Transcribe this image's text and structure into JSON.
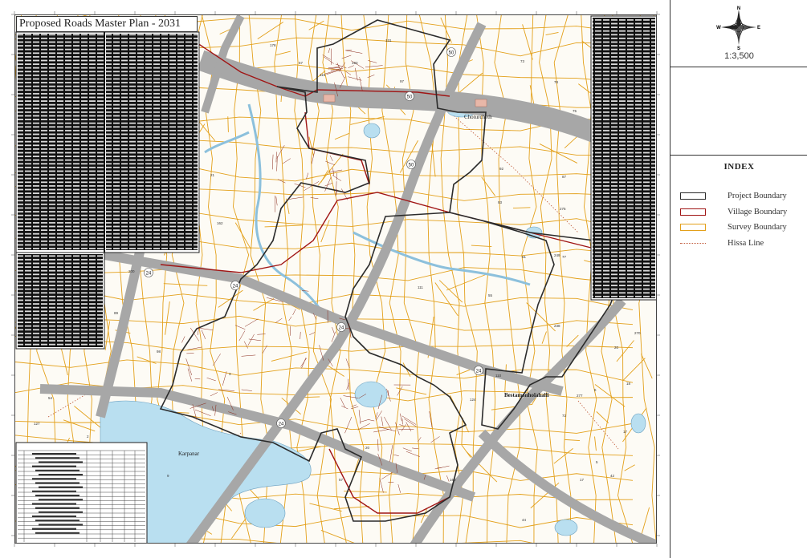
{
  "map": {
    "title": "Proposed Roads Master Plan - 2031",
    "scale": "1:3,500",
    "compass": {
      "n": "N",
      "s": "S",
      "e": "E",
      "w": "W"
    },
    "place_labels": [
      "Choturcheth",
      "Bestamonholahalli",
      "Karpanar"
    ],
    "road_labels": [
      "50",
      "50",
      "50",
      "24",
      "24",
      "24",
      "24",
      "24"
    ],
    "parcel_numbers": [
      "178",
      "57",
      "131",
      "193",
      "115",
      "97",
      "73",
      "78",
      "75",
      "87",
      "92",
      "93",
      "74",
      "61",
      "77",
      "55",
      "43",
      "54",
      "89",
      "98",
      "127",
      "2",
      "9",
      "3",
      "57",
      "275",
      "249",
      "238",
      "72",
      "20",
      "277",
      "270",
      "6",
      "5",
      "42",
      "17",
      "18",
      "17",
      "21",
      "200",
      "162",
      "111",
      "160",
      "124",
      "110",
      "20",
      "44"
    ],
    "colors": {
      "project_boundary": "#2b2b2b",
      "village_boundary": "#a01515",
      "survey_boundary": "#e3a01a",
      "hissa_line": "#c05a3a",
      "water": "#b9dff0",
      "road": "#a7a7a7"
    }
  },
  "index": {
    "title": "INDEX",
    "items": [
      {
        "label": "Project Boundary",
        "color": "#2b2b2b",
        "style": "box"
      },
      {
        "label": "Village Boundary",
        "color": "#a01515",
        "style": "box"
      },
      {
        "label": "Survey Boundary",
        "color": "#e3a01a",
        "style": "box"
      },
      {
        "label": "Hissa Line",
        "color": "#c05a3a",
        "style": "dotted"
      }
    ]
  }
}
